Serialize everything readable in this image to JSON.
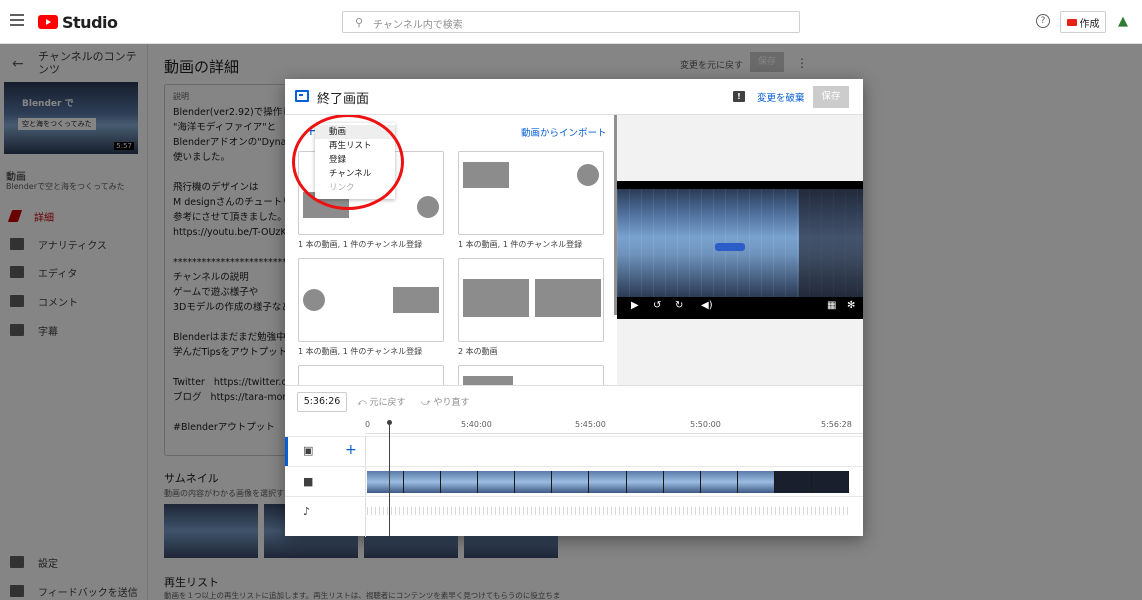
{
  "topbar": {
    "logo_text": "Studio",
    "search_placeholder": "チャンネル内で検索",
    "create_label": "作成"
  },
  "sidebar": {
    "title": "チャンネルのコンテンツ",
    "thumb_text_1": "Blender で",
    "thumb_text_2": "空と海をつくってみた",
    "thumb_duration": "5:57",
    "video_label": "動画",
    "video_title": "Blenderで空と海をつくってみた",
    "nav": [
      {
        "label": "詳細",
        "icon": "pencil-icon"
      },
      {
        "label": "アナリティクス",
        "icon": "analytics-icon"
      },
      {
        "label": "エディタ",
        "icon": "editor-icon"
      },
      {
        "label": "コメント",
        "icon": "comment-icon"
      },
      {
        "label": "字幕",
        "icon": "subtitles-icon"
      }
    ],
    "bottom": [
      {
        "label": "設定",
        "icon": "gear-icon"
      },
      {
        "label": "フィードバックを送信",
        "icon": "feedback-icon"
      }
    ]
  },
  "main": {
    "page_title": "動画の詳細",
    "undo_label": "変更を元に戻す",
    "save_label": "保存",
    "desc_label": "説明",
    "desc_text": "Blender(ver2.92)で操作して\n\"海洋モディファイア\"と\nBlenderアドオンの\"Dynamic\n使いました。\n\n飛行機のデザインは\nM designさんのチュートリ\n参考にさせて頂きました。\nhttps://youtu.be/T-OUzKaCA\n\n**********************************\nチャンネルの説明\nゲームで遊ぶ様子や\n3Dモデルの作成の様子など\n\nBlenderはまだまだ勉強中で\n学んだTipsをアウトプットで\n\nTwitter   https://twitter.com/\nブログ   https://tara-momor\n\n#Blenderアウトプット",
    "thumbnail_title": "サムネイル",
    "thumbnail_sub": "動画の内容がわかる画像を選択す",
    "playlist_title": "再生リスト",
    "playlist_sub": "動画を１つ以上の再生リストに追加します。再生リストは、視聴者にコンテンツを素早く見つけてもらうのに役立ちま"
  },
  "modal": {
    "title": "終了画面",
    "discard_label": "変更を破棄",
    "save_label": "保存",
    "import_label": "動画からインポート",
    "add_menu": [
      "動画",
      "再生リスト",
      "登録",
      "チャンネル",
      "リンク"
    ],
    "templates": [
      {
        "caption": "1 本の動画, 1 件のチャンネル登録"
      },
      {
        "caption": "1 本の動画, 1 件のチャンネル登録"
      },
      {
        "caption": "1 本の動画, 1 件のチャンネル登録"
      },
      {
        "caption": "2 本の動画"
      }
    ],
    "timeline": {
      "timecode": "5:36:26",
      "undo_label": "元に戻す",
      "redo_label": "やり直す",
      "ticks": [
        "0",
        "5:40:00",
        "5:45:00",
        "5:50:00",
        "5:56:28"
      ]
    }
  },
  "colors": {
    "accent": "#065fd4",
    "brand_red": "#ff0000",
    "annotation_red": "#e11111"
  }
}
